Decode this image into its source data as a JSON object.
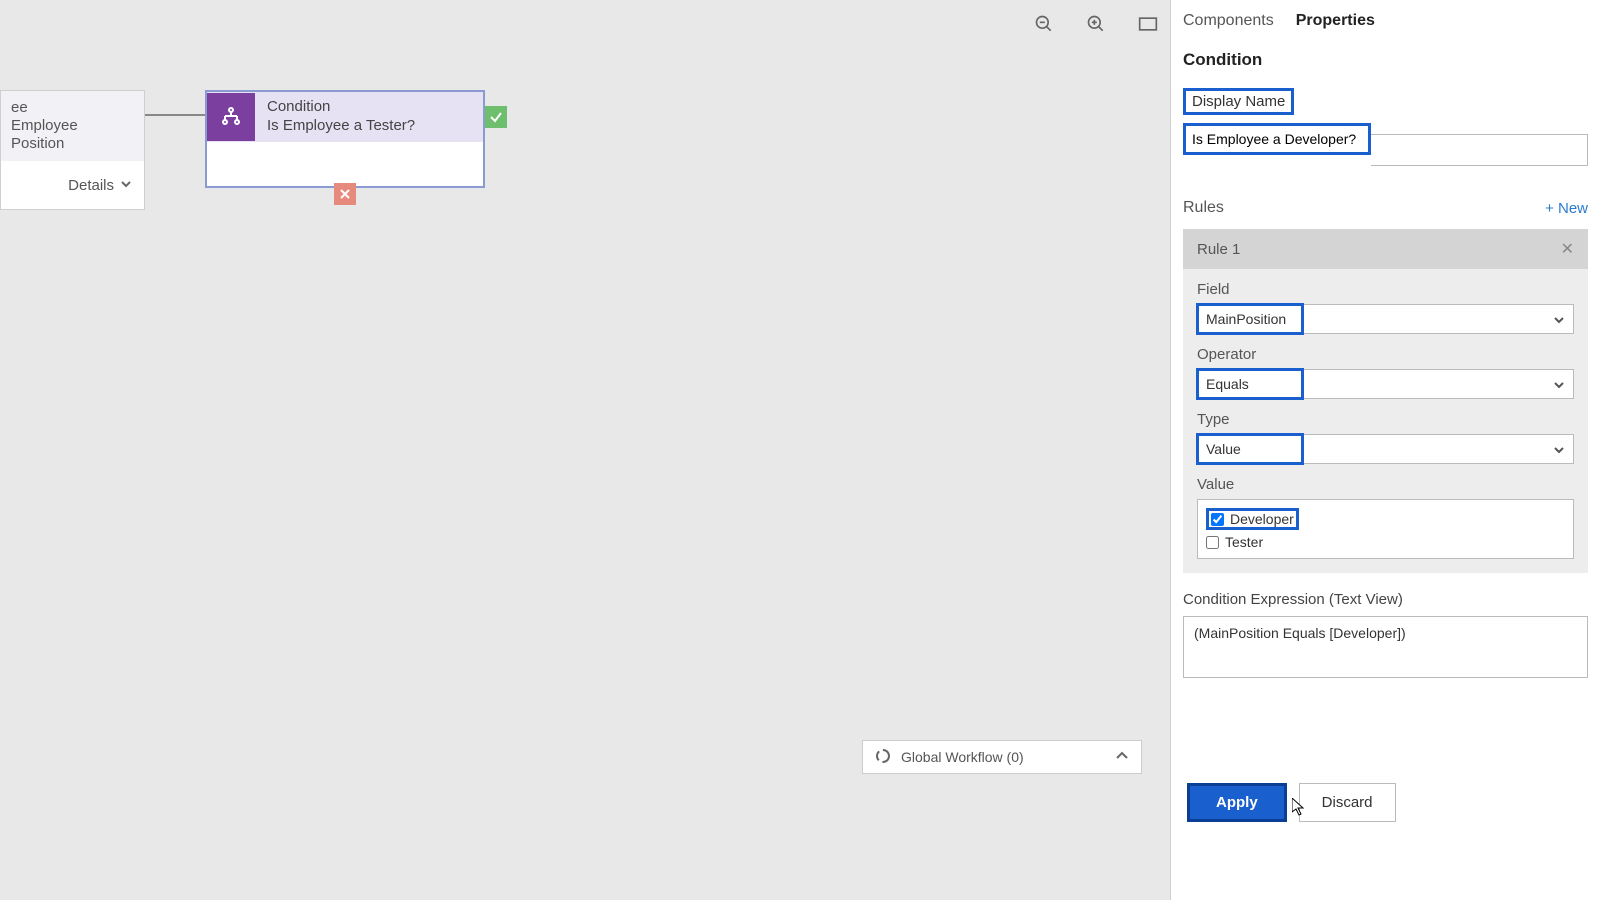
{
  "canvas": {
    "node_partial": {
      "line1": "ee",
      "line2": "Employee Position",
      "details_label": "Details"
    },
    "node_condition": {
      "type_label": "Condition",
      "title": "Is Employee a Tester?"
    },
    "global_workflow_label": "Global Workflow (0)"
  },
  "toolbar": {
    "zoom_out": "zoom-out",
    "zoom_in": "zoom-in",
    "fit": "fit-screen"
  },
  "panel": {
    "tabs": {
      "components": "Components",
      "properties": "Properties"
    },
    "section_title": "Condition",
    "display_name_label": "Display Name",
    "display_name_value": "Is Employee a Developer?",
    "rules_label": "Rules",
    "new_label": "+ New",
    "rule": {
      "title": "Rule 1",
      "field_label": "Field",
      "field_value": "MainPosition",
      "operator_label": "Operator",
      "operator_value": "Equals",
      "type_label": "Type",
      "type_value": "Value",
      "value_label": "Value",
      "options": {
        "opt1": "Developer",
        "opt2": "Tester"
      }
    },
    "expr_label": "Condition Expression (Text View)",
    "expr_value": "(MainPosition Equals [Developer])",
    "apply_label": "Apply",
    "discard_label": "Discard"
  }
}
